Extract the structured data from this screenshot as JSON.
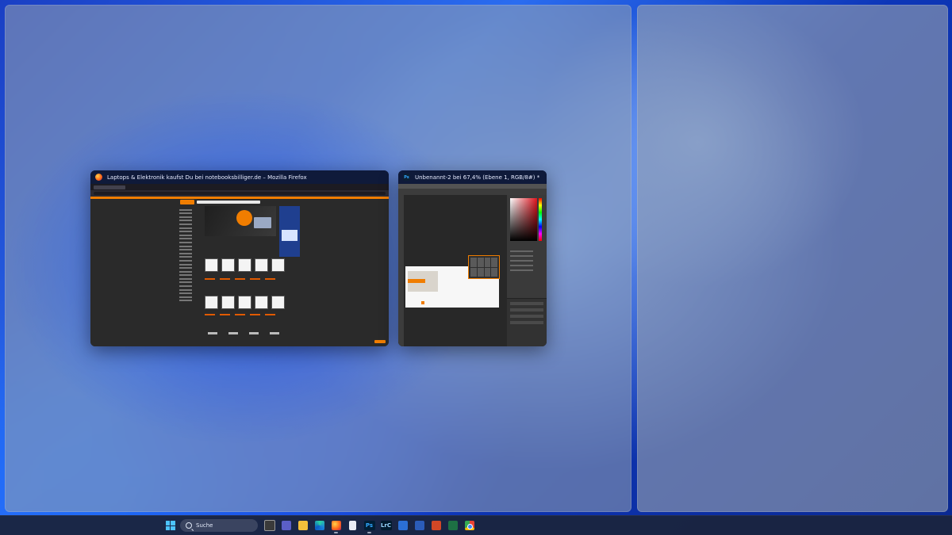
{
  "snap_assist": {
    "windows": [
      {
        "app": "Mozilla Firefox",
        "title": "Laptops & Elektronik kaufst Du bei notebooksbilliger.de – Mozilla Firefox",
        "icon": "firefox-icon"
      },
      {
        "app": "Adobe Photoshop",
        "title": "Unbenannt-2 bei 67,4% (Ebene 1, RGB/8#) *",
        "icon": "photoshop-icon",
        "icon_text": "Ps"
      }
    ]
  },
  "taskbar": {
    "start_icon": "windows-logo-icon",
    "search_placeholder": "Suche",
    "pinned": [
      {
        "name": "task-view-icon"
      },
      {
        "name": "teams-meet-icon"
      },
      {
        "name": "file-explorer-icon"
      },
      {
        "name": "edge-icon"
      },
      {
        "name": "firefox-icon",
        "running": true
      },
      {
        "name": "notepad-icon"
      },
      {
        "name": "photoshop-icon",
        "label": "Ps",
        "running": true
      },
      {
        "name": "lightroom-classic-icon",
        "label": "LrC"
      },
      {
        "name": "remote-desktop-icon"
      },
      {
        "name": "word-icon"
      },
      {
        "name": "powerpoint-icon"
      },
      {
        "name": "excel-icon"
      },
      {
        "name": "chrome-icon"
      }
    ]
  },
  "colors": {
    "accent_orange": "#f07d00",
    "win_blue": "#4cc2ff",
    "taskbar_bg": "#1a2440"
  }
}
